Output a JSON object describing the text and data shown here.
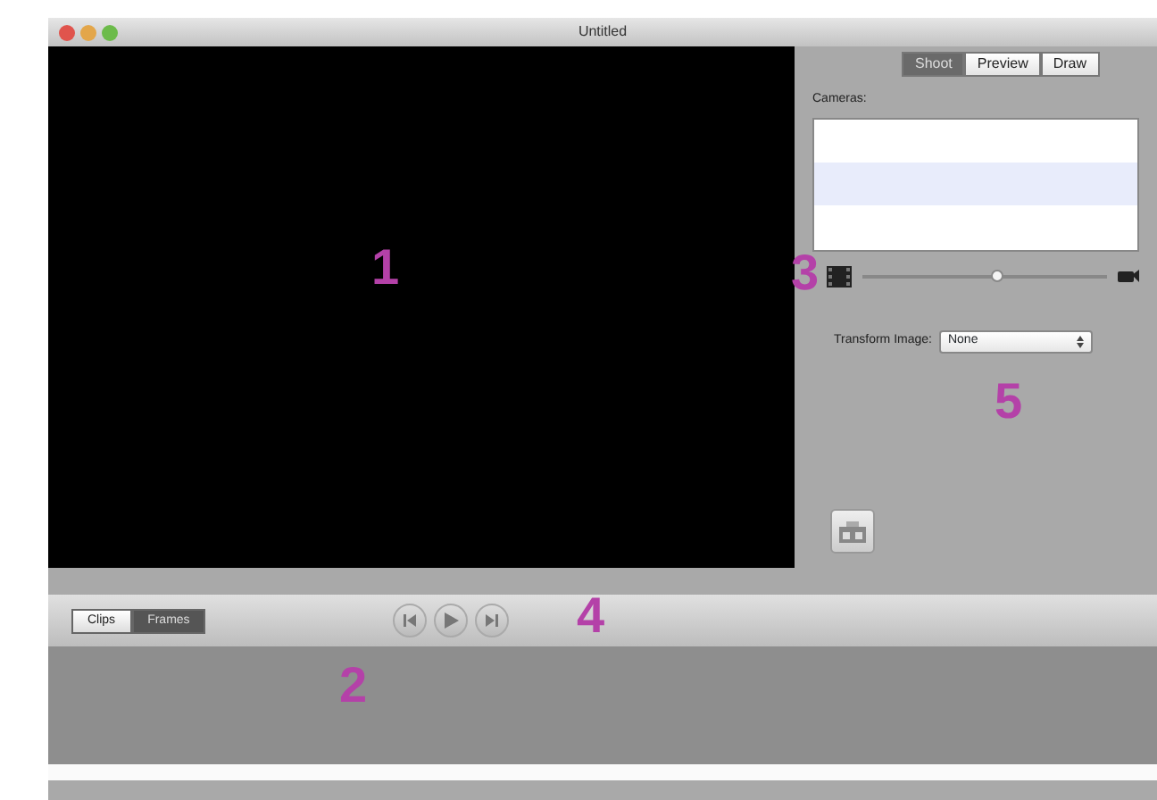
{
  "window": {
    "title": "Untitled"
  },
  "mode_tabs": [
    {
      "label": "Shoot",
      "selected": true
    },
    {
      "label": "Preview",
      "selected": false
    },
    {
      "label": "Draw",
      "selected": false
    }
  ],
  "cameras": {
    "label": "Cameras:",
    "rows": [
      {
        "selected": false
      },
      {
        "selected": true
      },
      {
        "selected": false
      }
    ]
  },
  "zoom_slider": {
    "level": 0.55
  },
  "transform": {
    "label": "Transform Image:",
    "value": "None"
  },
  "view_tabs": [
    {
      "label": "Clips",
      "selected": false
    },
    {
      "label": "Frames",
      "selected": true
    }
  ],
  "callouts": [
    "1",
    "2",
    "3",
    "4",
    "5"
  ]
}
